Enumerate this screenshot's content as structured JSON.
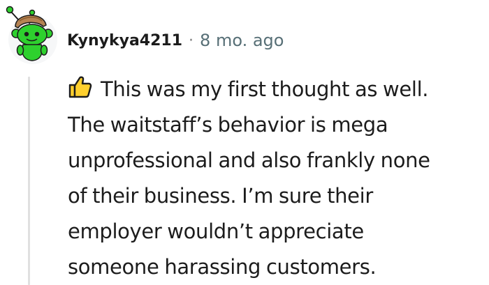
{
  "comment": {
    "author": "Kynykya4211",
    "separator": "·",
    "timestamp": "8 mo. ago",
    "avatar_icon": "snoo-avatar-icon",
    "reaction_icon": "thumbs-up-icon",
    "body_lines": [
      "This was my first thought as well.",
      "The waitstaff’s behavior is mega",
      "unprofessional and also frankly none",
      "of their business. I’m sure their",
      "employer wouldn’t appreciate",
      "someone harassing customers."
    ]
  },
  "colors": {
    "text": "#1c1c1c",
    "meta": "#576f76",
    "thread_line": "#e0e0e0",
    "avatar_green": "#2ed12e",
    "avatar_background": "#f6f7f8",
    "thumb_yellow": "#ffd02e"
  }
}
